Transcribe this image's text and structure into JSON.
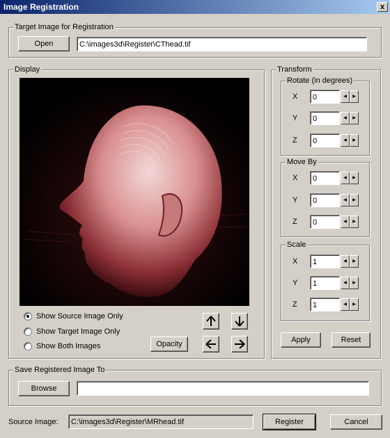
{
  "window": {
    "title": "Image Registration",
    "close_label": "x"
  },
  "target": {
    "legend": "Target Image for Registration",
    "open_label": "Open",
    "path": "C:\\images3d\\Register\\CThead.tif"
  },
  "display": {
    "legend": "Display",
    "radios": [
      {
        "label": "Show Source Image Only",
        "selected": true
      },
      {
        "label": "Show Target Image Only",
        "selected": false
      },
      {
        "label": "Show Both  Images",
        "selected": false
      }
    ],
    "opacity_label": "Opacity",
    "arrows": {
      "up": "🡑",
      "down": "🡓",
      "left": "🡐",
      "right": "🡒"
    }
  },
  "transform": {
    "legend": "Transform",
    "rotate": {
      "legend": "Rotate (in degrees)",
      "x_label": "X",
      "y_label": "Y",
      "z_label": "Z",
      "x": "0",
      "y": "0",
      "z": "0"
    },
    "move": {
      "legend": "Move By",
      "x_label": "X",
      "y_label": "Y",
      "z_label": "Z",
      "x": "0",
      "y": "0",
      "z": "0"
    },
    "scale": {
      "legend": "Scale",
      "x_label": "X",
      "y_label": "Y",
      "z_label": "Z",
      "x": "1",
      "y": "1",
      "z": "1"
    },
    "apply_label": "Apply",
    "reset_label": "Reset",
    "spin_left": "◀",
    "spin_right": "▶"
  },
  "save": {
    "legend": "Save Registered Image To",
    "browse_label": "Browse",
    "path": ""
  },
  "footer": {
    "source_label": "Source Image:",
    "source_path": "C:\\images3d\\Register\\MRhead.tif",
    "register_label": "Register",
    "cancel_label": "Cancel"
  }
}
